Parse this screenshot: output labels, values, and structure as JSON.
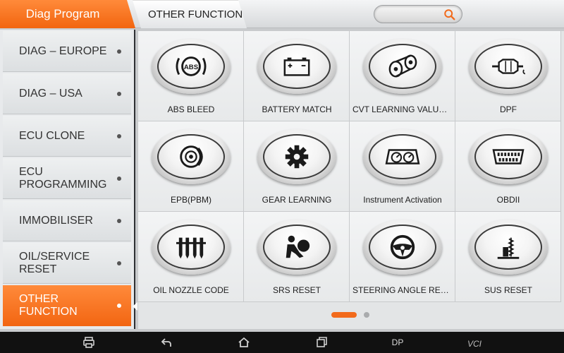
{
  "header": {
    "diag_tab": "Diag Program",
    "other_tab": "OTHER FUNCTION",
    "search_placeholder": ""
  },
  "sidebar": {
    "items": [
      {
        "label": "DIAG – EUROPE",
        "active": false
      },
      {
        "label": "DIAG – USA",
        "active": false
      },
      {
        "label": "ECU CLONE",
        "active": false
      },
      {
        "label": "ECU PROGRAMMING",
        "active": false
      },
      {
        "label": "IMMOBILISER",
        "active": false
      },
      {
        "label": "OIL/SERVICE RESET",
        "active": false
      },
      {
        "label": "OTHER FUNCTION",
        "active": true
      }
    ]
  },
  "functions": [
    {
      "label": "ABS BLEED",
      "icon": "abs-icon"
    },
    {
      "label": "BATTERY MATCH",
      "icon": "battery-icon"
    },
    {
      "label": "CVT LEARNING VALUE···",
      "icon": "cvt-belt-icon"
    },
    {
      "label": "DPF",
      "icon": "dpf-filter-icon"
    },
    {
      "label": "EPB(PBM)",
      "icon": "brake-disc-icon"
    },
    {
      "label": "GEAR LEARNING",
      "icon": "gear-icon"
    },
    {
      "label": "Instrument Activation",
      "icon": "instrument-cluster-icon"
    },
    {
      "label": "OBDII",
      "icon": "obd-connector-icon"
    },
    {
      "label": "OIL NOZZLE CODE",
      "icon": "injector-icon"
    },
    {
      "label": "SRS RESET",
      "icon": "airbag-icon"
    },
    {
      "label": "STEERING ANGLE RESET",
      "icon": "steering-wheel-icon"
    },
    {
      "label": "SUS RESET",
      "icon": "suspension-icon"
    }
  ],
  "pager": {
    "pages": 2,
    "current": 1
  },
  "navbar": {
    "dp_label": "DP",
    "vci_label": "VCI"
  },
  "colors": {
    "accent": "#f26a1b",
    "background": "#e3e5e6",
    "navbar": "#111111"
  }
}
